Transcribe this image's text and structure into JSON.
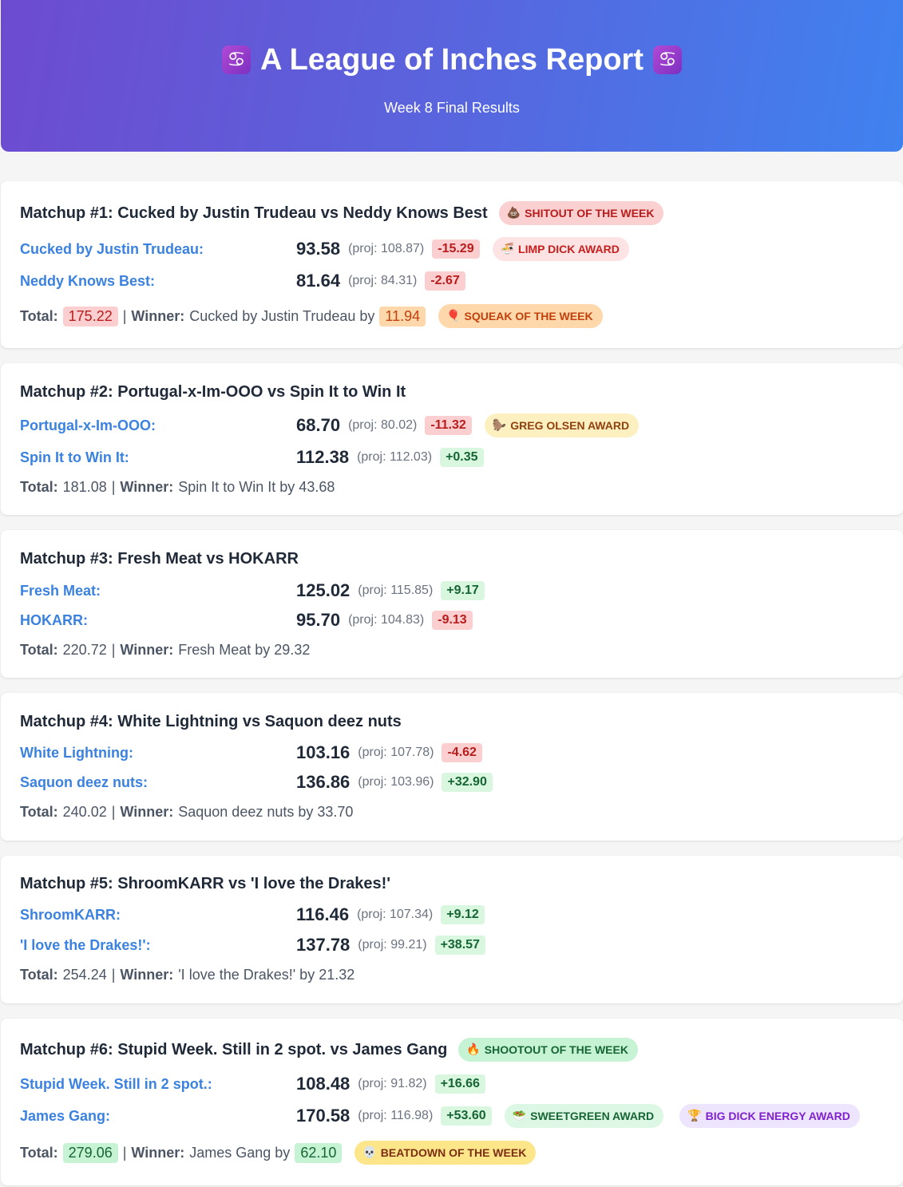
{
  "header": {
    "title": "A League of Inches Report",
    "icon_left": "♋",
    "icon_right": "♋",
    "subtitle": "Week 8 Final Results"
  },
  "matchups": [
    {
      "title": "Matchup #1: Cucked by Justin Trudeau vs Neddy Knows Best",
      "title_badge": {
        "icon": "💩",
        "label": "SHITOUT OF THE WEEK"
      },
      "team1": {
        "name": "Cucked by Justin Trudeau:",
        "score": "93.58",
        "proj": "(proj: 108.87)",
        "diff": "-15.29",
        "badge": {
          "icon": "🍜",
          "label": "LIMP DICK AWARD"
        }
      },
      "team2": {
        "name": "Neddy Knows Best:",
        "score": "81.64",
        "proj": "(proj: 84.31)",
        "diff": "-2.67"
      },
      "total_label": "Total:",
      "total": "175.22",
      "winner_label": "Winner:",
      "winner": "Cucked by Justin Trudeau by",
      "margin": "11.94",
      "total_badge": {
        "icon": "🎈",
        "label": "SQUEAK OF THE WEEK"
      }
    },
    {
      "title": "Matchup #2: Portugal-x-Im-OOO vs Spin It to Win It",
      "team1": {
        "name": "Portugal-x-Im-OOO:",
        "score": "68.70",
        "proj": "(proj: 80.02)",
        "diff": "-11.32",
        "badge": {
          "icon": "🦫",
          "label": "GREG OLSEN AWARD"
        }
      },
      "team2": {
        "name": "Spin It to Win It:",
        "score": "112.38",
        "proj": "(proj: 112.03)",
        "diff": "+0.35"
      },
      "total_label": "Total:",
      "total": "181.08",
      "winner_label": "Winner:",
      "winner": "Spin It to Win It by 43.68"
    },
    {
      "title": "Matchup #3: Fresh Meat vs HOKARR",
      "team1": {
        "name": "Fresh Meat:",
        "score": "125.02",
        "proj": "(proj: 115.85)",
        "diff": "+9.17"
      },
      "team2": {
        "name": "HOKARR:",
        "score": "95.70",
        "proj": "(proj: 104.83)",
        "diff": "-9.13"
      },
      "total_label": "Total:",
      "total": "220.72",
      "winner_label": "Winner:",
      "winner": "Fresh Meat by 29.32"
    },
    {
      "title": "Matchup #4: White Lightning vs Saquon deez nuts",
      "team1": {
        "name": "White Lightning:",
        "score": "103.16",
        "proj": "(proj: 107.78)",
        "diff": "-4.62"
      },
      "team2": {
        "name": "Saquon deez nuts:",
        "score": "136.86",
        "proj": "(proj: 103.96)",
        "diff": "+32.90"
      },
      "total_label": "Total:",
      "total": "240.02",
      "winner_label": "Winner:",
      "winner": "Saquon deez nuts by 33.70"
    },
    {
      "title": "Matchup #5: ShroomKARR vs 'I love the Drakes!'",
      "team1": {
        "name": "ShroomKARR:",
        "score": "116.46",
        "proj": "(proj: 107.34)",
        "diff": "+9.12"
      },
      "team2": {
        "name": "'I love the Drakes!':",
        "score": "137.78",
        "proj": "(proj: 99.21)",
        "diff": "+38.57"
      },
      "total_label": "Total:",
      "total": "254.24",
      "winner_label": "Winner:",
      "winner": "'I love the Drakes!' by 21.32"
    },
    {
      "title": "Matchup #6: Stupid Week. Still in 2 spot. vs James Gang",
      "title_badge": {
        "icon": "🔥",
        "label": "SHOOTOUT OF THE WEEK"
      },
      "team1": {
        "name": "Stupid Week. Still in 2 spot.:",
        "score": "108.48",
        "proj": "(proj: 91.82)",
        "diff": "+16.66"
      },
      "team2": {
        "name": "James Gang:",
        "score": "170.58",
        "proj": "(proj: 116.98)",
        "diff": "+53.60",
        "badge": {
          "icon": "🥗",
          "label": "SWEETGREEN AWARD"
        },
        "badge2": {
          "icon": "🏆",
          "label": "BIG DICK ENERGY AWARD"
        }
      },
      "total_label": "Total:",
      "total": "279.06",
      "winner_label": "Winner:",
      "winner": "James Gang by",
      "margin": "62.10",
      "total_badge": {
        "icon": "💀",
        "label": "BEATDOWN OF THE WEEK"
      }
    }
  ]
}
